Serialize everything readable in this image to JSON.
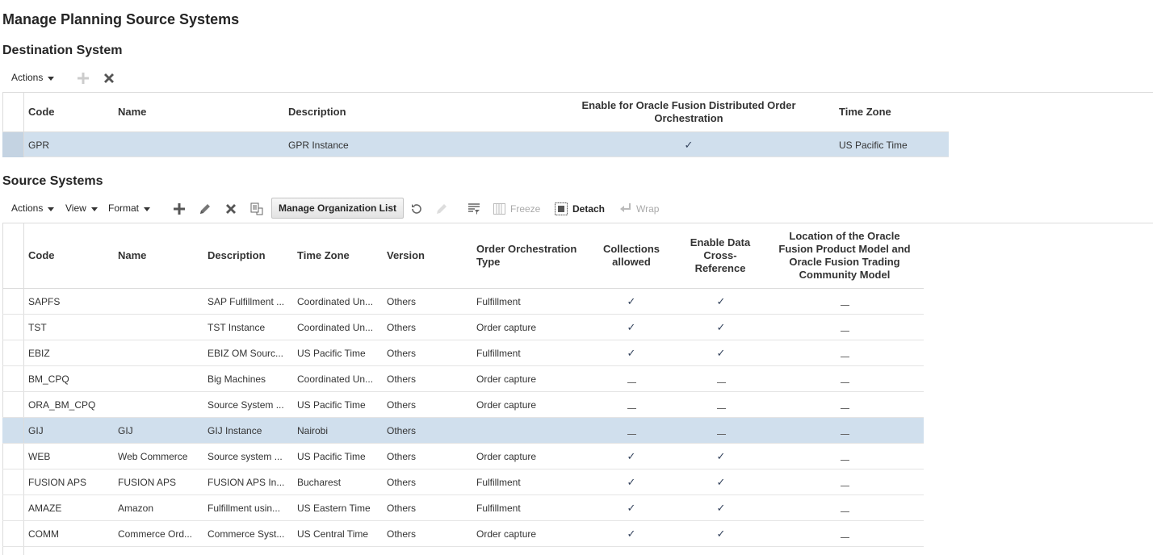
{
  "page_title": "Manage Planning Source Systems",
  "destination": {
    "heading": "Destination System",
    "toolbar": {
      "actions_label": "Actions"
    },
    "columns": [
      "Code",
      "Name",
      "Description",
      "Enable for Oracle Fusion Distributed Order Orchestration",
      "Time Zone"
    ],
    "row": {
      "code": "GPR",
      "name": "",
      "description": "GPR Instance",
      "enable_dooo": true,
      "time_zone": "US Pacific Time"
    }
  },
  "source": {
    "heading": "Source Systems",
    "toolbar": {
      "actions_label": "Actions",
      "view_label": "View",
      "format_label": "Format",
      "manage_org_label": "Manage Organization List",
      "freeze_label": "Freeze",
      "detach_label": "Detach",
      "wrap_label": "Wrap"
    },
    "columns": {
      "code": "Code",
      "name": "Name",
      "description": "Description",
      "time_zone": "Time Zone",
      "version": "Version",
      "order_type": "Order Orchestration Type",
      "collections": "Collections allowed",
      "xref": "Enable Data Cross-Reference",
      "location": "Location of the Oracle Fusion Product Model and Oracle Fusion Trading Community Model"
    },
    "rows": [
      {
        "code": "SAPFS",
        "name": "",
        "description": "SAP Fulfillment ...",
        "time_zone": "Coordinated Un...",
        "version": "Others",
        "order_type": "Fulfillment",
        "collections": true,
        "xref": true,
        "location": false
      },
      {
        "code": "TST",
        "name": "",
        "description": "TST Instance",
        "time_zone": "Coordinated Un...",
        "version": "Others",
        "order_type": "Order capture",
        "collections": true,
        "xref": true,
        "location": false
      },
      {
        "code": "EBIZ",
        "name": "",
        "description": "EBIZ OM Sourc...",
        "time_zone": "US Pacific Time",
        "version": "Others",
        "order_type": "Fulfillment",
        "collections": true,
        "xref": true,
        "location": false
      },
      {
        "code": "BM_CPQ",
        "name": "",
        "description": "Big Machines",
        "time_zone": "Coordinated Un...",
        "version": "Others",
        "order_type": "Order capture",
        "collections": false,
        "xref": false,
        "location": false
      },
      {
        "code": "ORA_BM_CPQ",
        "name": "",
        "description": "Source System ...",
        "time_zone": "US Pacific Time",
        "version": "Others",
        "order_type": "Order capture",
        "collections": false,
        "xref": false,
        "location": false
      },
      {
        "code": "GIJ",
        "name": "GIJ",
        "description": "GIJ Instance",
        "time_zone": "Nairobi",
        "version": "Others",
        "order_type": "",
        "collections": false,
        "xref": false,
        "location": false,
        "selected": true
      },
      {
        "code": "WEB",
        "name": "Web Commerce",
        "description": "Source system ...",
        "time_zone": "US Pacific Time",
        "version": "Others",
        "order_type": "Order capture",
        "collections": true,
        "xref": true,
        "location": false
      },
      {
        "code": "FUSION APS",
        "name": "FUSION APS",
        "description": "FUSION APS In...",
        "time_zone": "Bucharest",
        "version": "Others",
        "order_type": "Fulfillment",
        "collections": true,
        "xref": true,
        "location": false
      },
      {
        "code": "AMAZE",
        "name": "Amazon",
        "description": "Fulfillment usin...",
        "time_zone": "US Eastern Time",
        "version": "Others",
        "order_type": "Fulfillment",
        "collections": true,
        "xref": true,
        "location": false
      },
      {
        "code": "COMM",
        "name": "Commerce Ord...",
        "description": "Commerce Syst...",
        "time_zone": "US Central Time",
        "version": "Others",
        "order_type": "Order capture",
        "collections": true,
        "xref": true,
        "location": false
      }
    ]
  },
  "colors": {
    "selected_row": "#d0dfed",
    "check": "#33425c"
  }
}
